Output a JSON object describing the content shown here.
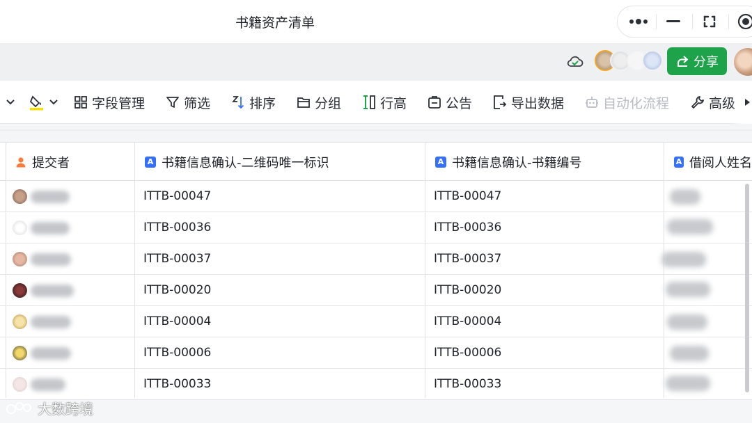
{
  "window": {
    "title": "书籍资产清单",
    "controls": [
      "more-icon",
      "minimize-icon",
      "restore-icon",
      "record-icon"
    ]
  },
  "share_bar": {
    "share_label": "分享",
    "sync_status_icon": "cloud-check-icon",
    "collaborator_count_visible": 3
  },
  "toolbar": {
    "items": [
      {
        "icon": "chevron-down-icon",
        "label": ""
      },
      {
        "icon": "fill-color-icon",
        "label": ""
      },
      {
        "icon": "grid-icon",
        "label": "字段管理"
      },
      {
        "icon": "filter-icon",
        "label": "筛选"
      },
      {
        "icon": "sort-icon",
        "label": "排序"
      },
      {
        "icon": "folder-icon",
        "label": "分组"
      },
      {
        "icon": "row-height-icon",
        "label": "行高"
      },
      {
        "icon": "announcement-icon",
        "label": "公告"
      },
      {
        "icon": "export-icon",
        "label": "导出数据"
      },
      {
        "icon": "robot-icon",
        "label": "自动化流程",
        "disabled": true
      },
      {
        "icon": "wrench-icon",
        "label": "高级"
      },
      {
        "icon": "triangle-right-icon",
        "label": ""
      }
    ]
  },
  "table": {
    "columns": [
      {
        "label": "提交者",
        "type": "person"
      },
      {
        "label": "书籍信息确认-二维码唯一标识",
        "type": "text"
      },
      {
        "label": "书籍信息确认-书籍编号",
        "type": "text"
      },
      {
        "label": "借阅人姓名",
        "type": "text"
      }
    ],
    "rows": [
      {
        "qr_id": "ITTB-00047",
        "book_no": "ITTB-00047"
      },
      {
        "qr_id": "ITTB-00036",
        "book_no": "ITTB-00036"
      },
      {
        "qr_id": "ITTB-00037",
        "book_no": "ITTB-00037"
      },
      {
        "qr_id": "ITTB-00020",
        "book_no": "ITTB-00020"
      },
      {
        "qr_id": "ITTB-00004",
        "book_no": "ITTB-00004"
      },
      {
        "qr_id": "ITTB-00006",
        "book_no": "ITTB-00006"
      },
      {
        "qr_id": "ITTB-00033",
        "book_no": "ITTB-00033"
      }
    ]
  },
  "watermark": {
    "text": "大数跨境"
  },
  "colors": {
    "accent": "#1fa34a",
    "field_icon": "#3370ff",
    "person_icon": "#f57e3c"
  }
}
